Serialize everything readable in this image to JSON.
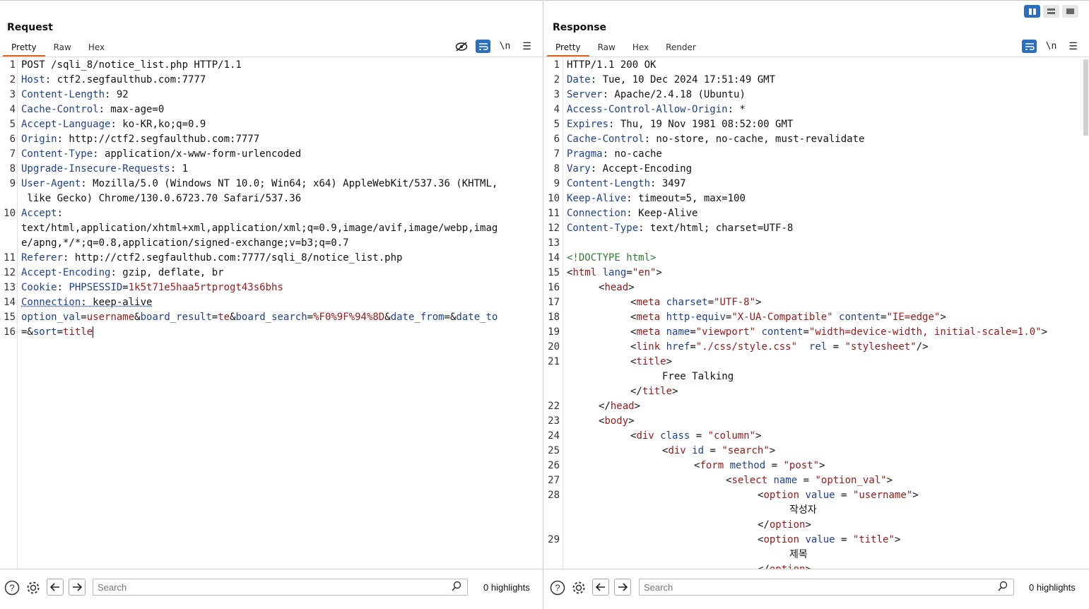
{
  "layout_controls": {
    "icons": [
      "split-vertical-icon",
      "split-horizontal-icon",
      "single-pane-icon"
    ]
  },
  "request": {
    "title": "Request",
    "tabs": [
      "Pretty",
      "Raw",
      "Hex"
    ],
    "active_tab": "Pretty",
    "tools": [
      "hide-icon",
      "wrap-icon",
      "newline-icon",
      "menu-icon"
    ],
    "lines": [
      {
        "n": "1",
        "k": "POST /sqli_8/notice_list.php HTTP/1.1",
        "v": ""
      },
      {
        "n": "2",
        "k": "Host",
        "v": ": ctf2.segfaulthub.com:7777"
      },
      {
        "n": "3",
        "k": "Content-Length",
        "v": ": 92"
      },
      {
        "n": "4",
        "k": "Cache-Control",
        "v": ": max-age=0"
      },
      {
        "n": "5",
        "k": "Accept-Language",
        "v": ": ko-KR,ko;q=0.9"
      },
      {
        "n": "6",
        "k": "Origin",
        "v": ": http://ctf2.segfaulthub.com:7777"
      },
      {
        "n": "7",
        "k": "Content-Type",
        "v": ": application/x-www-form-urlencoded"
      },
      {
        "n": "8",
        "k": "Upgrade-Insecure-Requests",
        "v": ": 1"
      },
      {
        "n": "9",
        "k": "User-Agent",
        "v": ": Mozilla/5.0 (Windows NT 10.0; Win64; x64) AppleWebKit/537.36 (KHTML,"
      },
      {
        "n": "",
        "k": "",
        "v": " like Gecko) Chrome/130.0.6723.70 Safari/537.36"
      },
      {
        "n": "10",
        "k": "Accept",
        "v": ":"
      },
      {
        "n": "",
        "k": "",
        "v": "text/html,application/xhtml+xml,application/xml;q=0.9,image/avif,image/webp,imag"
      },
      {
        "n": "",
        "k": "",
        "v": "e/apng,*/*;q=0.8,application/signed-exchange;v=b3;q=0.7"
      },
      {
        "n": "11",
        "k": "Referer",
        "v": ": http://ctf2.segfaulthub.com:7777/sqli_8/notice_list.php"
      },
      {
        "n": "12",
        "k": "Accept-Encoding",
        "v": ": gzip, deflate, br"
      },
      {
        "n": "13",
        "k": "Cookie",
        "v": ": "
      },
      {
        "n": "14",
        "k": "Connection",
        "v": ": keep-alive"
      },
      {
        "n": "15",
        "k": "",
        "v": ""
      },
      {
        "n": "16",
        "k": "",
        "v": ""
      },
      {
        "n": "",
        "k": "",
        "v": ""
      }
    ],
    "cookie": {
      "name": "PHPSESSID",
      "value": "1k5t71e5haa5rtprogt43s6bhs"
    },
    "body_line1": [
      {
        "t": "option_val",
        "c": "pk"
      },
      {
        "t": "=",
        "c": "hv"
      },
      {
        "t": "username",
        "c": "pv"
      },
      {
        "t": "&",
        "c": "hv"
      },
      {
        "t": "board_result",
        "c": "pk"
      },
      {
        "t": "=",
        "c": "hv"
      },
      {
        "t": "te",
        "c": "pv"
      },
      {
        "t": "&",
        "c": "hv"
      },
      {
        "t": "board_search",
        "c": "pk"
      },
      {
        "t": "=",
        "c": "hv"
      },
      {
        "t": "%F0%9F%94%8D",
        "c": "pv"
      },
      {
        "t": "&",
        "c": "hv"
      },
      {
        "t": "date_from",
        "c": "pk"
      },
      {
        "t": "=&",
        "c": "hv"
      },
      {
        "t": "date_to",
        "c": "pk"
      }
    ],
    "body_line2": [
      {
        "t": "=&",
        "c": "hv"
      },
      {
        "t": "sort",
        "c": "pk"
      },
      {
        "t": "=",
        "c": "hv"
      },
      {
        "t": "title",
        "c": "pv"
      }
    ],
    "search_placeholder": "Search",
    "highlights": "0 highlights"
  },
  "response": {
    "title": "Response",
    "tabs": [
      "Pretty",
      "Raw",
      "Hex",
      "Render"
    ],
    "active_tab": "Pretty",
    "tools": [
      "wrap-icon",
      "newline-icon",
      "menu-icon"
    ],
    "headers": [
      {
        "n": "1",
        "k": "HTTP/1.1 200 OK",
        "v": ""
      },
      {
        "n": "2",
        "k": "Date",
        "v": ": Tue, 10 Dec 2024 17:51:49 GMT"
      },
      {
        "n": "3",
        "k": "Server",
        "v": ": Apache/2.4.18 (Ubuntu)"
      },
      {
        "n": "4",
        "k": "Access-Control-Allow-Origin",
        "v": ": *"
      },
      {
        "n": "5",
        "k": "Expires",
        "v": ": Thu, 19 Nov 1981 08:52:00 GMT"
      },
      {
        "n": "6",
        "k": "Cache-Control",
        "v": ": no-store, no-cache, must-revalidate"
      },
      {
        "n": "7",
        "k": "Pragma",
        "v": ": no-cache"
      },
      {
        "n": "8",
        "k": "Vary",
        "v": ": Accept-Encoding"
      },
      {
        "n": "9",
        "k": "Content-Length",
        "v": ": 3497"
      },
      {
        "n": "10",
        "k": "Keep-Alive",
        "v": ": timeout=5, max=100"
      },
      {
        "n": "11",
        "k": "Connection",
        "v": ": Keep-Alive"
      },
      {
        "n": "12",
        "k": "Content-Type",
        "v": ": text/html; charset=UTF-8"
      },
      {
        "n": "13",
        "k": "",
        "v": ""
      }
    ],
    "html_lines": [
      {
        "n": "14",
        "i": 0,
        "p": [
          [
            "<!DOCTYPE html>",
            "dt"
          ]
        ]
      },
      {
        "n": "15",
        "i": 0,
        "p": [
          [
            "<",
            "tg"
          ],
          [
            "html",
            "tag"
          ],
          [
            " lang",
            "at"
          ],
          [
            "=",
            "tg"
          ],
          [
            "\"en\"",
            "sv"
          ],
          [
            ">",
            "tg"
          ]
        ]
      },
      {
        "n": "16",
        "i": 1,
        "p": [
          [
            "<",
            "tg"
          ],
          [
            "head",
            "tag"
          ],
          [
            ">",
            "tg"
          ]
        ]
      },
      {
        "n": "17",
        "i": 2,
        "p": [
          [
            "<",
            "tg"
          ],
          [
            "meta",
            "tag"
          ],
          [
            " charset",
            "at"
          ],
          [
            "=",
            "tg"
          ],
          [
            "\"UTF-8\"",
            "sv"
          ],
          [
            ">",
            "tg"
          ]
        ]
      },
      {
        "n": "18",
        "i": 2,
        "p": [
          [
            "<",
            "tg"
          ],
          [
            "meta",
            "tag"
          ],
          [
            " http-equiv",
            "at"
          ],
          [
            "=",
            "tg"
          ],
          [
            "\"X-UA-Compatible\"",
            "sv"
          ],
          [
            " content",
            "at"
          ],
          [
            "=",
            "tg"
          ],
          [
            "\"IE=edge\"",
            "sv"
          ],
          [
            ">",
            "tg"
          ]
        ]
      },
      {
        "n": "19",
        "i": 2,
        "p": [
          [
            "<",
            "tg"
          ],
          [
            "meta",
            "tag"
          ],
          [
            " name",
            "at"
          ],
          [
            "=",
            "tg"
          ],
          [
            "\"viewport\"",
            "sv"
          ],
          [
            " content",
            "at"
          ],
          [
            "=",
            "tg"
          ],
          [
            "\"width=device-width, initial-scale=1.0\"",
            "sv"
          ],
          [
            ">",
            "tg"
          ]
        ]
      },
      {
        "n": "20",
        "i": 2,
        "p": [
          [
            "<",
            "tg"
          ],
          [
            "link",
            "tag"
          ],
          [
            " href",
            "at"
          ],
          [
            "=",
            "tg"
          ],
          [
            "\"./css/style.css\"",
            "sv"
          ],
          [
            "  rel",
            "at"
          ],
          [
            " = ",
            "tg"
          ],
          [
            "\"stylesheet\"",
            "sv"
          ],
          [
            "/>",
            "tg"
          ]
        ]
      },
      {
        "n": "21",
        "i": 2,
        "p": [
          [
            "<",
            "tg"
          ],
          [
            "title",
            "tag"
          ],
          [
            ">",
            "tg"
          ]
        ]
      },
      {
        "n": "",
        "i": 3,
        "p": [
          [
            "Free Talking",
            "tg"
          ]
        ]
      },
      {
        "n": "",
        "i": 2,
        "p": [
          [
            "</",
            "tg"
          ],
          [
            "title",
            "tag"
          ],
          [
            ">",
            "tg"
          ]
        ]
      },
      {
        "n": "22",
        "i": 1,
        "p": [
          [
            "</",
            "tg"
          ],
          [
            "head",
            "tag"
          ],
          [
            ">",
            "tg"
          ]
        ]
      },
      {
        "n": "23",
        "i": 1,
        "p": [
          [
            "<",
            "tg"
          ],
          [
            "body",
            "tag"
          ],
          [
            ">",
            "tg"
          ]
        ]
      },
      {
        "n": "24",
        "i": 2,
        "p": [
          [
            "<",
            "tg"
          ],
          [
            "div",
            "tag"
          ],
          [
            " class",
            "at"
          ],
          [
            " = ",
            "tg"
          ],
          [
            "\"column\"",
            "sv"
          ],
          [
            ">",
            "tg"
          ]
        ]
      },
      {
        "n": "25",
        "i": 3,
        "p": [
          [
            "<",
            "tg"
          ],
          [
            "div",
            "tag"
          ],
          [
            " id",
            "at"
          ],
          [
            " = ",
            "tg"
          ],
          [
            "\"search\"",
            "sv"
          ],
          [
            ">",
            "tg"
          ]
        ]
      },
      {
        "n": "26",
        "i": 4,
        "p": [
          [
            "<",
            "tg"
          ],
          [
            "form",
            "tag"
          ],
          [
            " method",
            "at"
          ],
          [
            " = ",
            "tg"
          ],
          [
            "\"post\"",
            "sv"
          ],
          [
            ">",
            "tg"
          ]
        ]
      },
      {
        "n": "27",
        "i": 5,
        "p": [
          [
            "<",
            "tg"
          ],
          [
            "select",
            "tag"
          ],
          [
            " name",
            "at"
          ],
          [
            " = ",
            "tg"
          ],
          [
            "\"option_val\"",
            "sv"
          ],
          [
            ">",
            "tg"
          ]
        ]
      },
      {
        "n": "28",
        "i": 6,
        "p": [
          [
            "<",
            "tg"
          ],
          [
            "option",
            "tag"
          ],
          [
            " value",
            "at"
          ],
          [
            " = ",
            "tg"
          ],
          [
            "\"username\"",
            "sv"
          ],
          [
            ">",
            "tg"
          ]
        ]
      },
      {
        "n": "",
        "i": 7,
        "p": [
          [
            "작성자",
            "tg"
          ]
        ]
      },
      {
        "n": "",
        "i": 6,
        "p": [
          [
            "</",
            "tg"
          ],
          [
            "option",
            "tag"
          ],
          [
            ">",
            "tg"
          ]
        ]
      },
      {
        "n": "29",
        "i": 6,
        "p": [
          [
            "<",
            "tg"
          ],
          [
            "option",
            "tag"
          ],
          [
            " value",
            "at"
          ],
          [
            " = ",
            "tg"
          ],
          [
            "\"title\"",
            "sv"
          ],
          [
            ">",
            "tg"
          ]
        ]
      },
      {
        "n": "",
        "i": 7,
        "p": [
          [
            "제목",
            "tg"
          ]
        ]
      },
      {
        "n": "",
        "i": 6,
        "p": [
          [
            "</",
            "tg"
          ],
          [
            "option",
            "tag"
          ],
          [
            ">",
            "tg"
          ]
        ]
      }
    ],
    "search_placeholder": "Search",
    "highlights": "0 highlights"
  },
  "footer_icons": [
    "help-icon",
    "settings-icon",
    "back-arrow-icon",
    "forward-arrow-icon",
    "search-icon"
  ]
}
